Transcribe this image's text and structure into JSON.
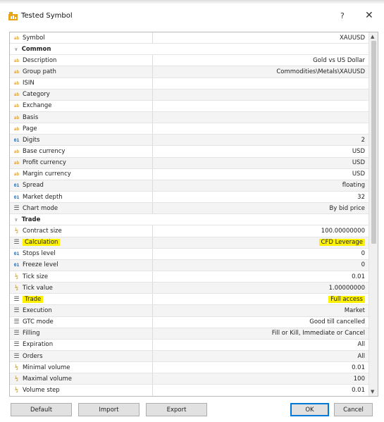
{
  "window": {
    "title": "Tested Symbol",
    "help": "?",
    "close": "✕"
  },
  "properties": [
    {
      "type": "row",
      "icon": "ab",
      "name": "Symbol",
      "value": "XAUUSD"
    },
    {
      "type": "section",
      "name": "Common"
    },
    {
      "type": "row",
      "icon": "ab",
      "name": "Description",
      "value": "Gold vs US Dollar"
    },
    {
      "type": "row",
      "icon": "ab",
      "name": "Group path",
      "value": "Commodities\\Metals\\XAUUSD"
    },
    {
      "type": "row",
      "icon": "ab",
      "name": "ISIN",
      "value": ""
    },
    {
      "type": "row",
      "icon": "ab",
      "name": "Category",
      "value": ""
    },
    {
      "type": "row",
      "icon": "ab",
      "name": "Exchange",
      "value": ""
    },
    {
      "type": "row",
      "icon": "ab",
      "name": "Basis",
      "value": ""
    },
    {
      "type": "row",
      "icon": "ab",
      "name": "Page",
      "value": ""
    },
    {
      "type": "row",
      "icon": "01",
      "name": "Digits",
      "value": "2"
    },
    {
      "type": "row",
      "icon": "ab",
      "name": "Base currency",
      "value": "USD"
    },
    {
      "type": "row",
      "icon": "ab",
      "name": "Profit currency",
      "value": "USD"
    },
    {
      "type": "row",
      "icon": "ab",
      "name": "Margin currency",
      "value": "USD"
    },
    {
      "type": "row",
      "icon": "01",
      "name": "Spread",
      "value": "floating"
    },
    {
      "type": "row",
      "icon": "01",
      "name": "Market depth",
      "value": "32"
    },
    {
      "type": "row",
      "icon": "list",
      "name": "Chart mode",
      "value": "By bid price"
    },
    {
      "type": "section",
      "name": "Trade"
    },
    {
      "type": "row",
      "icon": "frac",
      "name": "Contract size",
      "value": "100.00000000"
    },
    {
      "type": "row",
      "icon": "list",
      "name": "Calculation",
      "value": "CFD Leverage",
      "highlight": true
    },
    {
      "type": "row",
      "icon": "01",
      "name": "Stops level",
      "value": "0"
    },
    {
      "type": "row",
      "icon": "01",
      "name": "Freeze level",
      "value": "0"
    },
    {
      "type": "row",
      "icon": "frac",
      "name": "Tick size",
      "value": "0.01"
    },
    {
      "type": "row",
      "icon": "frac",
      "name": "Tick value",
      "value": "1.00000000"
    },
    {
      "type": "row",
      "icon": "list",
      "name": "Trade",
      "value": "Full access",
      "highlight": true
    },
    {
      "type": "row",
      "icon": "list",
      "name": "Execution",
      "value": "Market"
    },
    {
      "type": "row",
      "icon": "list",
      "name": "GTC mode",
      "value": "Good till cancelled"
    },
    {
      "type": "row",
      "icon": "list",
      "name": "Filling",
      "value": "Fill or Kill, Immediate or Cancel"
    },
    {
      "type": "row",
      "icon": "list",
      "name": "Expiration",
      "value": "All"
    },
    {
      "type": "row",
      "icon": "list",
      "name": "Orders",
      "value": "All"
    },
    {
      "type": "row",
      "icon": "frac",
      "name": "Minimal volume",
      "value": "0.01"
    },
    {
      "type": "row",
      "icon": "frac",
      "name": "Maximal volume",
      "value": "100"
    },
    {
      "type": "row",
      "icon": "frac",
      "name": "Volume step",
      "value": "0.01"
    }
  ],
  "icons": {
    "ab": "ab",
    "01": "01",
    "frac": "½",
    "list": "☰"
  },
  "buttons": {
    "default": "Default",
    "import": "Import",
    "export": "Export",
    "ok": "OK",
    "cancel": "Cancel"
  },
  "colors": {
    "highlight": "#fff200",
    "ok_border": "#0078d7"
  }
}
